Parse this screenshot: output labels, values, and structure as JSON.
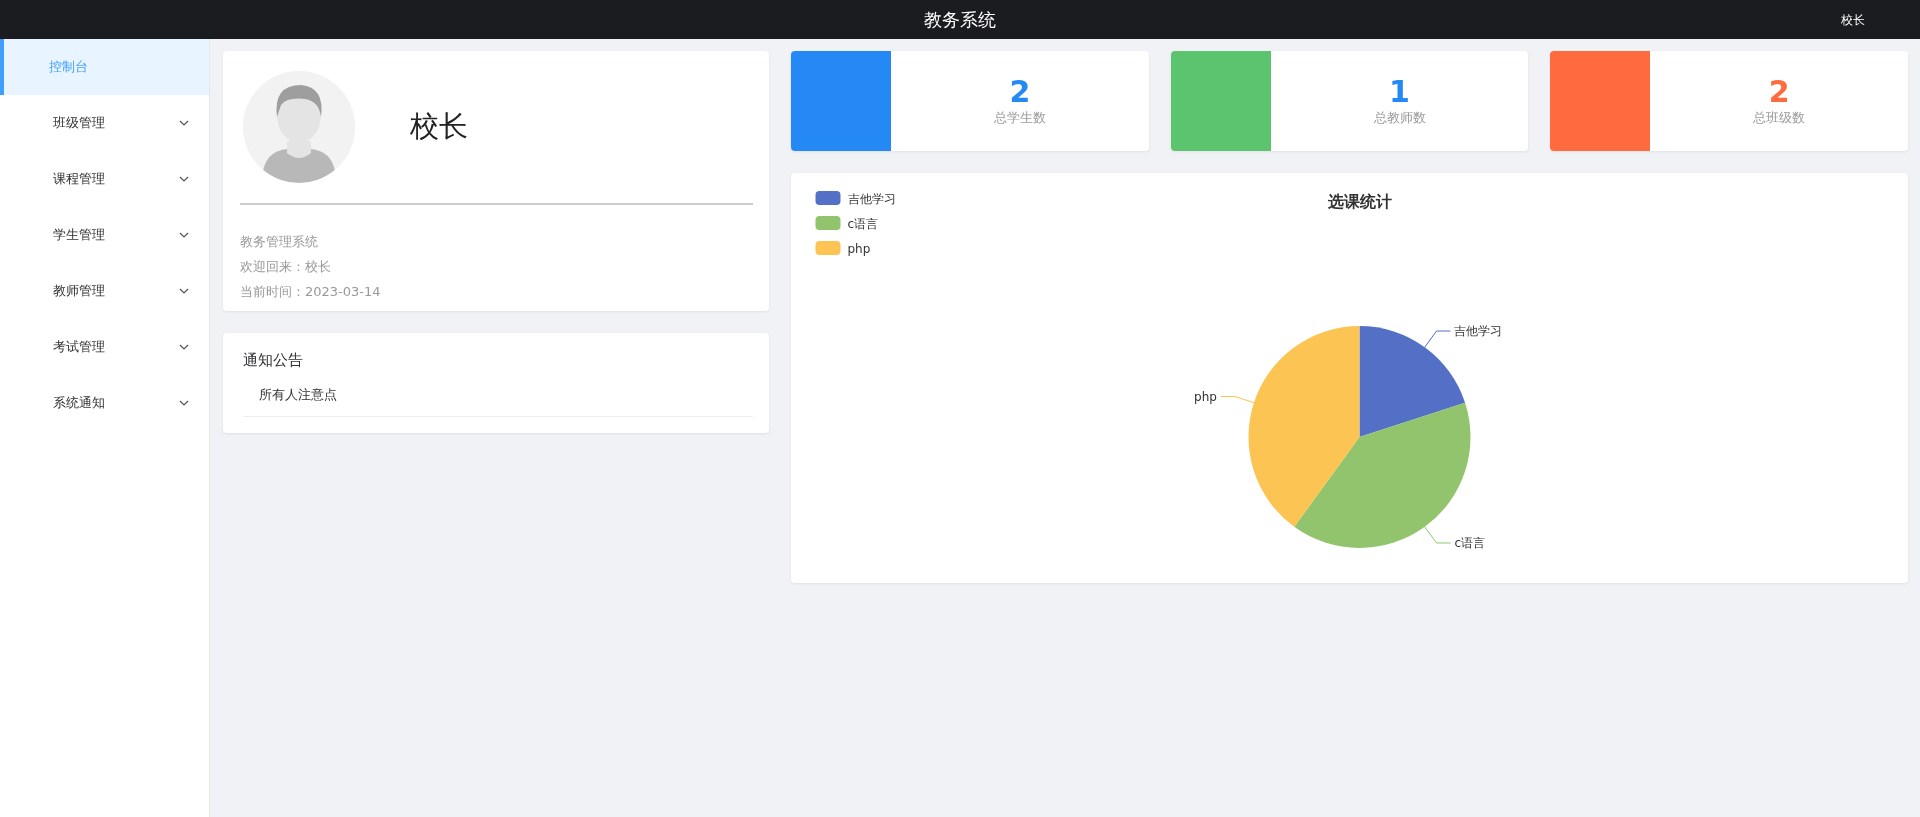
{
  "header": {
    "title": "教务系统",
    "user": "校长"
  },
  "sidebar": {
    "items": [
      {
        "label": "控制台",
        "selected": true,
        "submenu": false
      },
      {
        "label": "班级管理",
        "selected": false,
        "submenu": true
      },
      {
        "label": "课程管理",
        "selected": false,
        "submenu": true
      },
      {
        "label": "学生管理",
        "selected": false,
        "submenu": true
      },
      {
        "label": "教师管理",
        "selected": false,
        "submenu": true
      },
      {
        "label": "考试管理",
        "selected": false,
        "submenu": true
      },
      {
        "label": "系统通知",
        "selected": false,
        "submenu": true
      }
    ]
  },
  "profile": {
    "name": "校长",
    "lines": [
      "教务管理系统",
      "欢迎回来：校长",
      "当前时间：2023-03-14"
    ]
  },
  "notices": {
    "title": "通知公告",
    "items": [
      "所有人注意点"
    ]
  },
  "stats": [
    {
      "value": {
        "text": "2",
        "color": "#2589f5"
      },
      "label": "总学生数",
      "color": "#2589f5"
    },
    {
      "value": {
        "text": "1",
        "color": "#2589f5"
      },
      "label": "总教师数",
      "color": "#5cc46e"
    },
    {
      "value": {
        "text": "2",
        "color": "#ff6b3f"
      },
      "label": "总班级数",
      "color": "#ff6b3f"
    }
  ],
  "chart": {
    "chart_data": {
      "type": "pie",
      "title": "选课统计",
      "categories": [
        "吉他学习",
        "c语言",
        "php"
      ],
      "values": [
        20,
        40,
        40
      ],
      "colors": [
        "#5470c6",
        "#91c46c",
        "#fcc453"
      ],
      "legend": "top-left"
    }
  }
}
